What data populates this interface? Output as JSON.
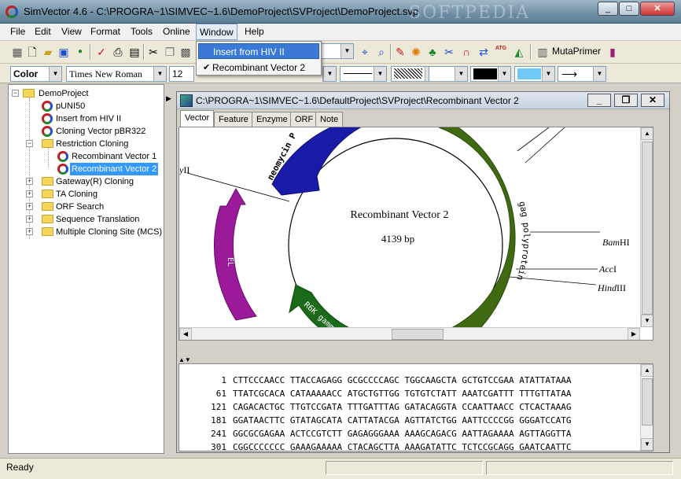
{
  "window": {
    "title": "SimVector 4.6 - C:\\PROGRA~1\\SIMVEC~1.6\\DemoProject\\SVProject\\DemoProject.svp",
    "watermark": "SOFTPEDIA",
    "minimize": "_",
    "maximize": "□",
    "close": "✕"
  },
  "menu": {
    "items": [
      "File",
      "Edit",
      "View",
      "Format",
      "Tools",
      "Online",
      "Window",
      "Help"
    ]
  },
  "window_menu": {
    "items": [
      {
        "label": "Insert from HIV II",
        "checked": false,
        "highlighted": true
      },
      {
        "label": "Recombinant Vector 2",
        "checked": true,
        "highlighted": false
      }
    ],
    "check_glyph": "✔"
  },
  "toolbar1": {
    "mutaprimer_label": "MutaPrimer",
    "atg_label": "ATG",
    "icons": [
      "open-icon",
      "new-icon",
      "open-folder-icon",
      "save-icon",
      "genbank-icon",
      "check-icon",
      "print-icon",
      "print-preview-icon",
      "cut-icon",
      "copy-icon",
      "paste-icon"
    ]
  },
  "toolbar2": {
    "style_combo": "Color",
    "font_combo": "Times New Roman",
    "size_combo": "12",
    "fill_color": "#000000",
    "line_color": "#6ec8f8"
  },
  "tree": {
    "root": "DemoProject",
    "nodes": [
      {
        "label": "pUNI50",
        "type": "vector",
        "level": 1
      },
      {
        "label": "Insert from HIV II",
        "type": "vector",
        "level": 1
      },
      {
        "label": "Cloning Vector pBR322",
        "type": "vector",
        "level": 1
      },
      {
        "label": "Restriction Cloning",
        "type": "folder",
        "level": 1,
        "expanded": true
      },
      {
        "label": "Recombinant Vector 1",
        "type": "vector",
        "level": 2
      },
      {
        "label": "Recombinant Vector 2",
        "type": "vector",
        "level": 2,
        "selected": true
      },
      {
        "label": "Gateway(R) Cloning",
        "type": "folder",
        "level": 1,
        "expanded": false
      },
      {
        "label": "TA Cloning",
        "type": "folder",
        "level": 1,
        "expanded": false
      },
      {
        "label": "ORF Search",
        "type": "folder",
        "level": 1,
        "expanded": false
      },
      {
        "label": "Sequence Translation",
        "type": "folder",
        "level": 1,
        "expanded": false
      },
      {
        "label": "Multiple Cloning Site (MCS)",
        "type": "folder",
        "level": 1,
        "expanded": false
      }
    ]
  },
  "child_window": {
    "title": "C:\\PROGRA~1\\SIMVEC~1.6\\DefaultProject\\SVProject\\Recombinant Vector 2",
    "tabs": [
      "Vector",
      "Feature",
      "Enzyme",
      "ORF",
      "Note"
    ],
    "active_tab": "Vector"
  },
  "map": {
    "name": "Recombinant Vector 2",
    "length": "4139 bp",
    "features": [
      {
        "label": "neomycin P",
        "color": "#1a1aa8"
      },
      {
        "label": "gag polyprotein",
        "color": "#3f6a12"
      },
      {
        "label": "EL",
        "color": "#9a1a9a"
      },
      {
        "label": "R6K gamma",
        "color": "#1a6a1a"
      }
    ],
    "sites": [
      {
        "label": "BamHI",
        "italic_part": "Bam",
        "roman_part": "HI"
      },
      {
        "label": "AccI",
        "italic_part": "Acc",
        "roman_part": "I"
      },
      {
        "label": "HindIII",
        "italic_part": "Hind",
        "roman_part": "III"
      },
      {
        "label": "yII",
        "italic_part": "y",
        "roman_part": "II"
      }
    ]
  },
  "sequence": {
    "lines": [
      {
        "pos": "1",
        "seq": "CTTCCCAACC TTACCAGAGG GCGCCCCAGC TGGCAAGCTA GCTGTCCGAA ATATTATAAA"
      },
      {
        "pos": "61",
        "seq": "TTATCGCACA CATAAAAACC ATGCTGTTGG TGTGTCTATT AAATCGATTT TTTGTTATAA"
      },
      {
        "pos": "121",
        "seq": "CAGACACTGC TTGTCCGATA TTTGATTTAG GATACAGGTA CCAATTAACC CTCACTAAAG"
      },
      {
        "pos": "181",
        "seq": "GGATAACTTC GTATAGCATA CATTATACGA AGTTATCTGG AATTCCCCGG GGGATCCATG"
      },
      {
        "pos": "241",
        "seq": "GGCGCGAGAA ACTCCGTCTT GAGAGGGAAA AAAGCAGACG AATTAGAAAA AGTTAGGTTA"
      },
      {
        "pos": "301",
        "seq": "CGGCCCCCCC GAAAGAAAAA CTACAGCTTA AAAGATATTC TCTCCGCAGG GAATCAATTC"
      }
    ]
  },
  "status": {
    "text": "Ready"
  }
}
